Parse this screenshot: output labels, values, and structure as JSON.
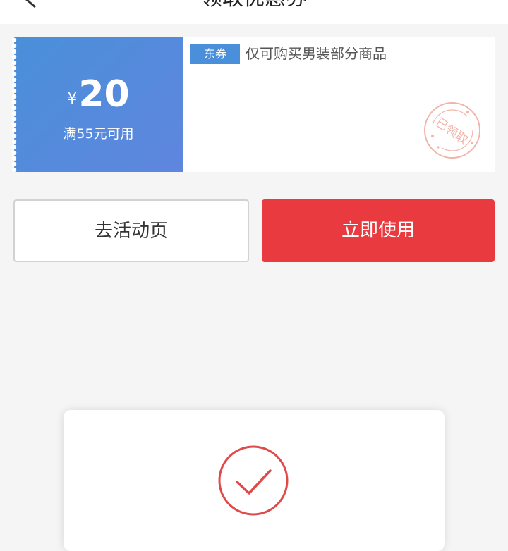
{
  "header": {
    "title": "领取优惠券"
  },
  "coupon": {
    "currency": "¥",
    "amount": "20",
    "condition": "满55元可用",
    "tag": "东券",
    "description": "仅可购买男装部分商品",
    "stamp_text": "已领取"
  },
  "actions": {
    "activity_label": "去活动页",
    "use_label": "立即使用"
  },
  "colors": {
    "coupon_blue": "#4a8fd9",
    "primary_red": "#e83a3f",
    "stamp_pink": "#f2b4a8"
  }
}
